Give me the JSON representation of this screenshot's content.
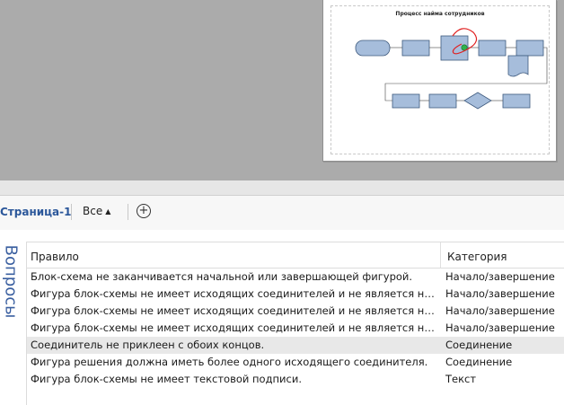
{
  "diagram": {
    "title": "Процесс найма сотрудников",
    "colors": {
      "shape_fill": "#a6bddb",
      "shape_stroke": "#3e5a7e",
      "connector": "#444444",
      "annotation": "#e02020",
      "marker": "#2fb34a"
    }
  },
  "issues_panel": {
    "page_tab": "Страница-1",
    "filter_label": "Все",
    "add_icon": "plus-circle-icon",
    "side_title": "Вопросы",
    "columns": {
      "rule": "Правило",
      "category": "Категория"
    },
    "rows": [
      {
        "rule": "Блок-схема не заканчивается начальной или завершающей фигурой.",
        "category": "Начало/завершение"
      },
      {
        "rule": "Фигура блок-схемы не имеет исходящих соединителей и не является начальной или завершающей фигурой.",
        "category": "Начало/завершение"
      },
      {
        "rule": "Фигура блок-схемы не имеет исходящих соединителей и не является начальной или завершающей фигурой.",
        "category": "Начало/завершение"
      },
      {
        "rule": "Фигура блок-схемы не имеет исходящих соединителей и не является начальной или завершающей фигурой.",
        "category": "Начало/завершение"
      },
      {
        "rule": "Соединитель не приклеен с обоих концов.",
        "category": "Соединение"
      },
      {
        "rule": "Фигура решения должна иметь более одного исходящего соединителя.",
        "category": "Соединение"
      },
      {
        "rule": "Фигура блок-схемы не имеет текстовой подписи.",
        "category": "Текст"
      }
    ],
    "selected_row": 4
  }
}
